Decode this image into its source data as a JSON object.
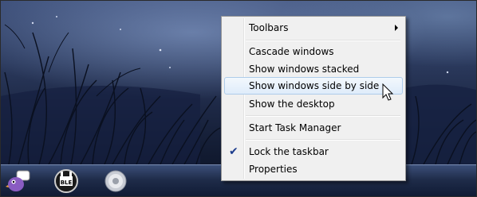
{
  "context_menu": {
    "items": [
      {
        "label": "Toolbars"
      },
      {
        "label": "Cascade windows"
      },
      {
        "label": "Show windows stacked"
      },
      {
        "label": "Show windows side by side"
      },
      {
        "label": "Show the desktop"
      },
      {
        "label": "Start Task Manager"
      },
      {
        "label": "Lock the taskbar"
      },
      {
        "label": "Properties"
      }
    ],
    "hovered_item": "Show windows side by side",
    "checked_item": "Lock the taskbar"
  },
  "taskbar": {
    "icons": [
      "pidgin-bird-icon",
      "uble-icon",
      "speaker-icon"
    ]
  },
  "colors": {
    "menu_bg": "#f0f0f0",
    "highlight_border": "#aeccea",
    "checkmark": "#1c3c8c"
  }
}
